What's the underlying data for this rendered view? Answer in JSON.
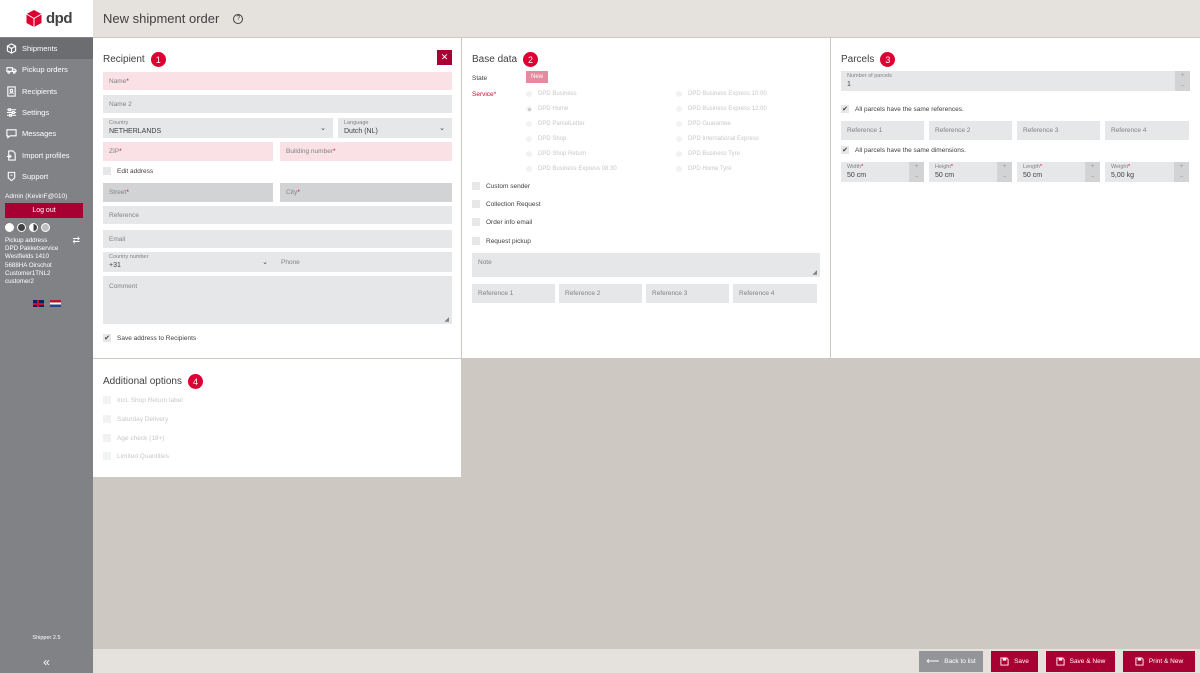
{
  "app": {
    "logo": "dpd"
  },
  "sidebar": {
    "items": [
      {
        "label": "Shipments",
        "icon": "box-icon"
      },
      {
        "label": "Pickup orders",
        "icon": "truck-icon"
      },
      {
        "label": "Recipients",
        "icon": "contacts-icon"
      },
      {
        "label": "Settings",
        "icon": "sliders-icon"
      },
      {
        "label": "Messages",
        "icon": "chat-icon"
      },
      {
        "label": "Import profiles",
        "icon": "file-import-icon"
      },
      {
        "label": "Support",
        "icon": "support-icon"
      }
    ],
    "user": "Admin (KevinF@010)",
    "logout": "Log out",
    "pickup_title": "Pickup address",
    "pickup_lines": [
      "DPD Pakketservice",
      "Westfields 1410",
      "5688HA Oirschot",
      "Customer1TNL2",
      "customer2"
    ],
    "version": "Shipper 2.5",
    "collapse": "«"
  },
  "header": {
    "title": "New shipment order",
    "help": "?"
  },
  "recipient": {
    "title": "Recipient",
    "badge": "1",
    "name": "Name",
    "name2": "Name 2",
    "country_label": "Country",
    "country_value": "NETHERLANDS",
    "language_label": "Language",
    "language_value": "Dutch (NL)",
    "zip": "ZIP",
    "building": "Building number",
    "edit_address": "Edit address",
    "street": "Street",
    "city": "City",
    "reference": "Reference",
    "email": "Email",
    "country_number_label": "Country number",
    "country_number_value": "+31",
    "phone": "Phone",
    "comment": "Comment",
    "save_address": "Save address to Recipients",
    "close": "✕"
  },
  "base": {
    "title": "Base data",
    "badge": "2",
    "state_label": "State",
    "state_value": "New",
    "service_label": "Service",
    "services_left": [
      "DPD Business",
      "DPD Home",
      "DPD ParcelLetter",
      "DPD Shop",
      "DPD Shop Return",
      "DPD Business Express 08:30"
    ],
    "services_right": [
      "DPD Business Express 10:00",
      "DPD Business Express 12:00",
      "DPD Guarantee",
      "DPD International Express",
      "DPD Business Tyre",
      "DPD Home Tyre"
    ],
    "options": [
      "Custom sender",
      "Collection Request",
      "Order info email",
      "Request pickup"
    ],
    "note": "Note",
    "references": [
      "Reference 1",
      "Reference 2",
      "Reference 3",
      "Reference 4"
    ]
  },
  "parcels": {
    "title": "Parcels",
    "badge": "3",
    "number_label": "Number of parcels",
    "number_value": "1",
    "same_refs": "All parcels have the same references.",
    "references": [
      "Reference 1",
      "Reference 2",
      "Reference 3",
      "Reference 4"
    ],
    "same_dims": "All parcels have the same dimensions.",
    "dims": [
      {
        "label": "Width",
        "value": "50 cm"
      },
      {
        "label": "Height",
        "value": "50 cm"
      },
      {
        "label": "Length",
        "value": "50 cm"
      },
      {
        "label": "Weight",
        "value": "5,00 kg"
      }
    ],
    "plus": "+",
    "minus": "–"
  },
  "additional": {
    "title": "Additional options",
    "badge": "4",
    "options": [
      "Incl. Shop Return label",
      "Saturday Delivery",
      "Age check (18+)",
      "Limited Quantities"
    ]
  },
  "footer": {
    "back": "Back to list",
    "save": "Save",
    "save_new": "Save & New",
    "print_new": "Print & New"
  },
  "colors": {
    "accent": "#dc0032",
    "button": "#a90034",
    "back_button": "#939598",
    "sidebar": "#808285"
  }
}
